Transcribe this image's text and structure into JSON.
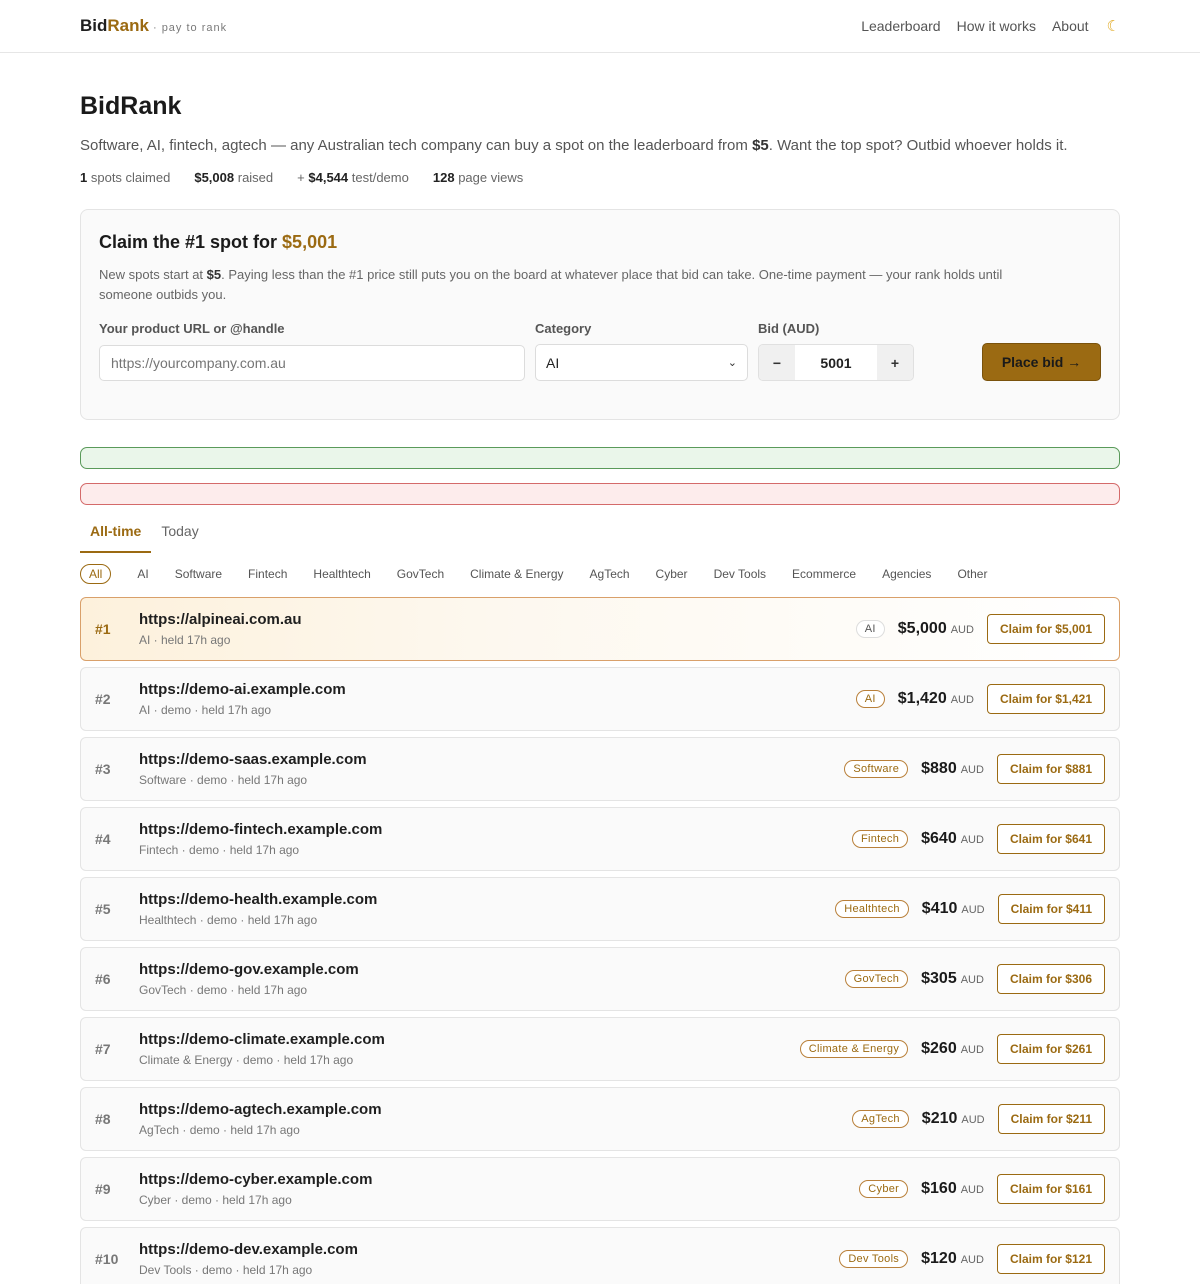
{
  "brand": {
    "bid": "Bid",
    "rank": "Rank",
    "tagline": "· pay to rank"
  },
  "nav": {
    "items": [
      "Leaderboard",
      "How it works",
      "About"
    ],
    "theme_icon": "moon-icon"
  },
  "hero": {
    "title": "BidRank",
    "subtitle_pre": "Software, AI, fintech, agtech — any Australian tech company can buy a spot on the leaderboard from ",
    "subtitle_price": "$5",
    "subtitle_post": ". Want the top spot? Outbid whoever holds it."
  },
  "stats": [
    {
      "value": "1",
      "label": "spots claimed",
      "prefix": ""
    },
    {
      "value": "$5,008",
      "label": "raised",
      "prefix": ""
    },
    {
      "value": "$4,544",
      "label": "test/demo",
      "prefix": "+ "
    },
    {
      "value": "128",
      "label": "page views",
      "prefix": ""
    }
  ],
  "claim": {
    "title_pre": "Claim the #1 spot for ",
    "title_price": "$5,001",
    "desc_pre": "New spots start at ",
    "desc_price": "$5",
    "desc_post": ". Paying less than the #1 price still puts you on the board at whatever place that bid can take. One-time payment — your rank holds until someone outbids you.",
    "url_label": "Your product URL or @handle",
    "url_placeholder": "https://yourcompany.com.au",
    "category_label": "Category",
    "category_value": "AI",
    "bid_label": "Bid (AUD)",
    "bid_value": "5001",
    "minus": "−",
    "plus": "+",
    "submit_label": "Place bid →"
  },
  "tabs": [
    "All-time",
    "Today"
  ],
  "filters": [
    "All",
    "AI",
    "Software",
    "Fintech",
    "Healthtech",
    "GovTech",
    "Climate & Energy",
    "AgTech",
    "Cyber",
    "Dev Tools",
    "Ecommerce",
    "Agencies",
    "Other"
  ],
  "leaderboard": [
    {
      "rank": "#1",
      "url": "https://alpineai.com.au",
      "meta": "AI · held 17h ago",
      "badge": "AI",
      "amount": "$5,000",
      "unit": "AUD",
      "claim": "Claim for $5,001"
    },
    {
      "rank": "#2",
      "url": "https://demo-ai.example.com",
      "meta": "AI · demo · held 17h ago",
      "badge": "AI",
      "amount": "$1,420",
      "unit": "AUD",
      "claim": "Claim for $1,421"
    },
    {
      "rank": "#3",
      "url": "https://demo-saas.example.com",
      "meta": "Software · demo · held 17h ago",
      "badge": "Software",
      "amount": "$880",
      "unit": "AUD",
      "claim": "Claim for $881"
    },
    {
      "rank": "#4",
      "url": "https://demo-fintech.example.com",
      "meta": "Fintech · demo · held 17h ago",
      "badge": "Fintech",
      "amount": "$640",
      "unit": "AUD",
      "claim": "Claim for $641"
    },
    {
      "rank": "#5",
      "url": "https://demo-health.example.com",
      "meta": "Healthtech · demo · held 17h ago",
      "badge": "Healthtech",
      "amount": "$410",
      "unit": "AUD",
      "claim": "Claim for $411"
    },
    {
      "rank": "#6",
      "url": "https://demo-gov.example.com",
      "meta": "GovTech · demo · held 17h ago",
      "badge": "GovTech",
      "amount": "$305",
      "unit": "AUD",
      "claim": "Claim for $306"
    },
    {
      "rank": "#7",
      "url": "https://demo-climate.example.com",
      "meta": "Climate & Energy · demo · held 17h ago",
      "badge": "Climate & Energy",
      "amount": "$260",
      "unit": "AUD",
      "claim": "Claim for $261"
    },
    {
      "rank": "#8",
      "url": "https://demo-agtech.example.com",
      "meta": "AgTech · demo · held 17h ago",
      "badge": "AgTech",
      "amount": "$210",
      "unit": "AUD",
      "claim": "Claim for $211"
    },
    {
      "rank": "#9",
      "url": "https://demo-cyber.example.com",
      "meta": "Cyber · demo · held 17h ago",
      "badge": "Cyber",
      "amount": "$160",
      "unit": "AUD",
      "claim": "Claim for $161"
    },
    {
      "rank": "#10",
      "url": "https://demo-dev.example.com",
      "meta": "Dev Tools · demo · held 17h ago",
      "badge": "Dev Tools",
      "amount": "$120",
      "unit": "AUD",
      "claim": "Claim for $121"
    }
  ],
  "colors": {
    "accent": "#9b6a12",
    "success_border": "#5a9a5a",
    "error_border": "#d46a6a"
  }
}
